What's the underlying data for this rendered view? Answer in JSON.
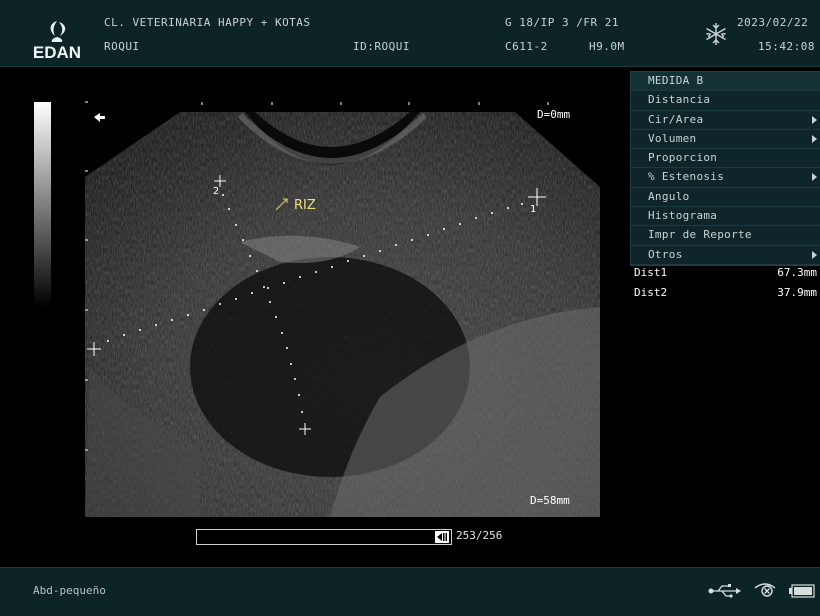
{
  "header": {
    "clinic": "CL. VETERINARIA HAPPY + KOTAS",
    "patient": "ROQUI",
    "patient_id": "ID:ROQUI",
    "gain_line": "G 18/IP 3 /FR 21",
    "probe": "C611-2",
    "freq": "H9.0M",
    "date": "2023/02/22",
    "time": "15:42:08",
    "logo_text": "EDAN",
    "freeze_icon": "snowflake-icon"
  },
  "image": {
    "depth_top": "D=0mm",
    "depth_bottom": "D=58mm",
    "annotation": "RIZ",
    "marker_1": "1",
    "marker_2": "2"
  },
  "menu": {
    "items": [
      {
        "label": "MEDIDA B",
        "arrow": false
      },
      {
        "label": "Distancia",
        "arrow": false
      },
      {
        "label": "Cir/Area",
        "arrow": true
      },
      {
        "label": "Volumen",
        "arrow": true
      },
      {
        "label": "Proporcion",
        "arrow": false
      },
      {
        "label": "% Estenosis",
        "arrow": true
      },
      {
        "label": "Angulo",
        "arrow": false
      },
      {
        "label": "Histograma",
        "arrow": false
      },
      {
        "label": "Impr de Reporte",
        "arrow": false
      },
      {
        "label": "Otros",
        "arrow": true
      }
    ]
  },
  "measurements": [
    {
      "name": "Dist1",
      "value": "67.3mm"
    },
    {
      "name": "Dist2",
      "value": "37.9mm"
    }
  ],
  "cine": {
    "frame": "253/256",
    "position_fraction": 0.99
  },
  "footer": {
    "preset": "Abd-pequeño",
    "icons": [
      "usb-icon",
      "network-icon",
      "battery-icon"
    ]
  }
}
